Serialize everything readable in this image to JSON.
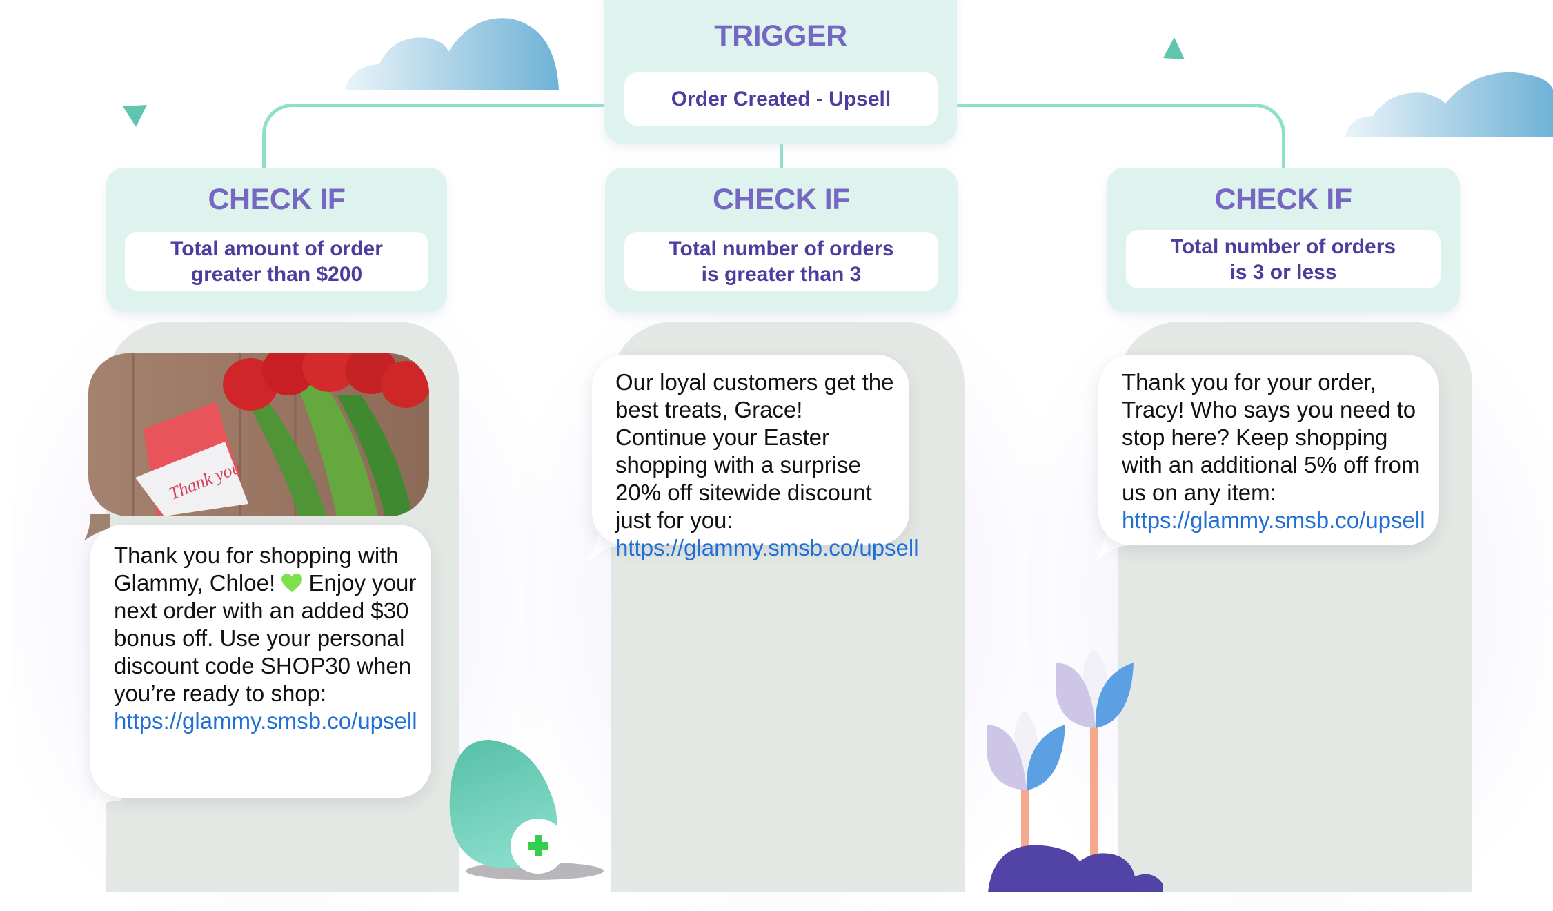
{
  "trigger": {
    "title": "TRIGGER",
    "value": "Order Created - Upsell"
  },
  "branches": [
    {
      "title": "CHECK IF",
      "condition_line1": "Total amount of order",
      "condition_line2": "greater than $200",
      "message": {
        "has_image": true,
        "image_note": "Thank you",
        "text_before_heart": "Thank you for shopping with Glammy, Chloe!",
        "text_after_heart": " Enjoy your next order with an added $30 bonus off. Use your personal discount code SHOP30 when you’re ready to shop: ",
        "link": "https://glammy.smsb.co/upsell"
      }
    },
    {
      "title": "CHECK IF",
      "condition_line1": "Total number of orders",
      "condition_line2": "is greater than 3",
      "message": {
        "text": "Our loyal customers get the best treats, Grace! Continue your Easter shopping with a surprise 20% off sitewide discount just for you: ",
        "link": "https://glammy.smsb.co/upsell"
      }
    },
    {
      "title": "CHECK IF",
      "condition_line1": "Total number of orders",
      "condition_line2": "is 3 or less",
      "message": {
        "text": "Thank you for your order, Tracy! Who says you need to stop here? Keep shopping with an additional 5% off from us on any item: ",
        "link": "https://glammy.smsb.co/upsell"
      }
    }
  ],
  "icons": {
    "heart": "green-heart-icon",
    "plus": "plus-icon"
  },
  "colors": {
    "title_purple": "#7668c2",
    "condition_purple": "#4e3c9e",
    "node_bg": "#dff3ee",
    "connector": "#8fe0cb",
    "link_blue": "#1f6fd6",
    "phone_bg": "#e3e8e4",
    "heart_green": "#7ee04a",
    "plus_green": "#35cf4f"
  }
}
